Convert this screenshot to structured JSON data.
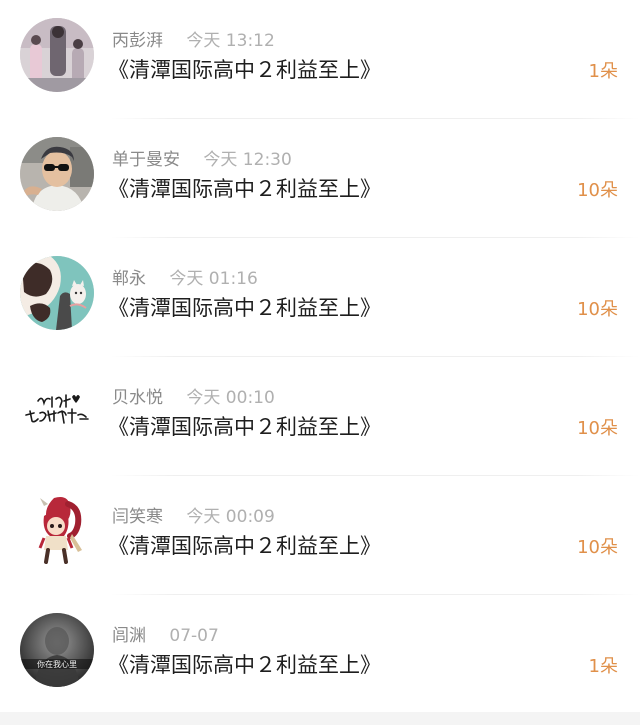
{
  "colors": {
    "name_text": "#8a8a8a",
    "time_text": "#b0b0b0",
    "message_text": "#1e1e1e",
    "count_accent": "#e0904a",
    "divider": "#efefef"
  },
  "comments": [
    {
      "name": "丙彭湃",
      "time": "今天 13:12",
      "message": "《清潭国际高中２利益至上》",
      "count": "1朵",
      "avatar_icon": "photo-avatar-group"
    },
    {
      "name": "单于曼安",
      "time": "今天 12:30",
      "message": "《清潭国际高中２利益至上》",
      "count": "10朵",
      "avatar_icon": "photo-avatar-sunglasses"
    },
    {
      "name": "郸永",
      "time": "今天 01:16",
      "message": "《清潭国际高中２利益至上》",
      "count": "10朵",
      "avatar_icon": "illustration-avatar-cat"
    },
    {
      "name": "贝水悦",
      "time": "今天 00:10",
      "message": "《清潭国际高中２利益至上》",
      "count": "10朵",
      "avatar_icon": "handwriting-avatar",
      "avatar_text": "一定要开心"
    },
    {
      "name": "闫笑寒",
      "time": "今天 00:09",
      "message": "《清潭国际高中２利益至上》",
      "count": "10朵",
      "avatar_icon": "cartoon-avatar-girl"
    },
    {
      "name": "闾渊",
      "time": "07-07",
      "message": "《清潭国际高中２利益至上》",
      "count": "1朵",
      "avatar_icon": "photo-avatar-dark",
      "avatar_text": "你在我心里"
    }
  ]
}
